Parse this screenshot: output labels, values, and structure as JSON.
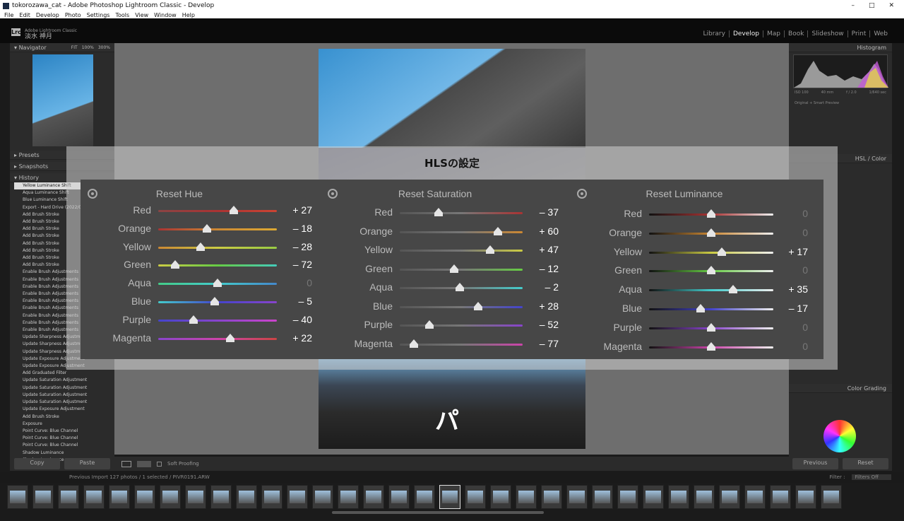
{
  "window": {
    "title": "tokorozawa_cat - Adobe Photoshop Lightroom Classic - Develop",
    "controls": [
      "–",
      "□",
      "✕"
    ]
  },
  "menu": [
    "File",
    "Edit",
    "Develop",
    "Photo",
    "Settings",
    "Tools",
    "View",
    "Window",
    "Help"
  ],
  "identity": {
    "logo": "Lrc",
    "line1": "Adobe Lightroom Classic",
    "line2": "淡水 神月"
  },
  "modules": [
    "Library",
    "Develop",
    "Map",
    "Book",
    "Slideshow",
    "Print",
    "Web"
  ],
  "left_panel": {
    "navigator": "Navigator",
    "nav_zoom": [
      "FIT",
      "100%",
      "300%"
    ],
    "presets": "Presets",
    "snapshots": "Snapshots",
    "history": "History",
    "history_items": [
      "Yellow Luminance Shift",
      "Aqua Luminance Shift",
      "Blue Luminance Shift",
      "Export - Hard Drive (2022/02/1",
      "Add Brush Stroke",
      "Add Brush Stroke",
      "Add Brush Stroke",
      "Add Brush Stroke",
      "Add Brush Stroke",
      "Add Brush Stroke",
      "Add Brush Stroke",
      "Add Brush Stroke",
      "Enable Brush Adjustments",
      "Enable Brush Adjustments",
      "Enable Brush Adjustments",
      "Enable Brush Adjustments",
      "Enable Brush Adjustments",
      "Enable Brush Adjustments",
      "Enable Brush Adjustments",
      "Enable Brush Adjustments",
      "Enable Brush Adjustments",
      "Update Sharpness Adjustment",
      "Update Sharpness Adjustment",
      "Update Sharpness Adjustment",
      "Update Exposure Adjustment",
      "Update Exposure Adjustment",
      "Add Graduated Filter",
      "Update Saturation Adjustment",
      "Update Saturation Adjustment",
      "Update Saturation Adjustment",
      "Update Saturation Adjustment",
      "Update Exposure Adjustment",
      "Add Brush Stroke",
      "Exposure",
      "Point Curve: Blue Channel",
      "Point Curve: Blue Channel",
      "Point Curve: Blue Channel",
      "Shadow Luminance",
      "Shadow Luminance"
    ],
    "copy": "Copy",
    "paste": "Paste"
  },
  "toolbar": {
    "soft_proofing": "Soft Proofing"
  },
  "right_panel": {
    "histogram": "Histogram",
    "exif": [
      "ISO 100",
      "40 mm",
      "f / 2.0",
      "1/640 sec"
    ],
    "original": "Original + Smart Preview",
    "hsl": "HSL / Color",
    "color_grading": "Color Grading",
    "previous": "Previous",
    "reset": "Reset"
  },
  "filmstrip": {
    "info": "Previous Import    127 photos / 1 selected / PIVR0191.ARW",
    "filter": "Filter :",
    "filters_off": "Filters Off"
  },
  "overlay": {
    "title": "HLSの設定",
    "footer_char": "パ"
  },
  "hls": {
    "labels": [
      "Red",
      "Orange",
      "Yellow",
      "Green",
      "Aqua",
      "Blue",
      "Purple",
      "Magenta"
    ],
    "hue": {
      "header": "Reset Hue",
      "values": [
        "+ 27",
        "– 18",
        "– 28",
        "– 72",
        "0",
        "– 5",
        "– 40",
        "+ 22"
      ],
      "nums": [
        27,
        -18,
        -28,
        -72,
        0,
        -5,
        -40,
        22
      ]
    },
    "saturation": {
      "header": "Reset Saturation",
      "values": [
        "– 37",
        "+ 60",
        "+ 47",
        "– 12",
        "– 2",
        "+ 28",
        "– 52",
        "– 77"
      ],
      "nums": [
        -37,
        60,
        47,
        -12,
        -2,
        28,
        -52,
        -77
      ]
    },
    "luminance": {
      "header": "Reset Luminance",
      "values": [
        "0",
        "0",
        "+ 17",
        "0",
        "+ 35",
        "– 17",
        "0",
        "0"
      ],
      "nums": [
        0,
        0,
        17,
        0,
        35,
        -17,
        0,
        0
      ]
    }
  }
}
